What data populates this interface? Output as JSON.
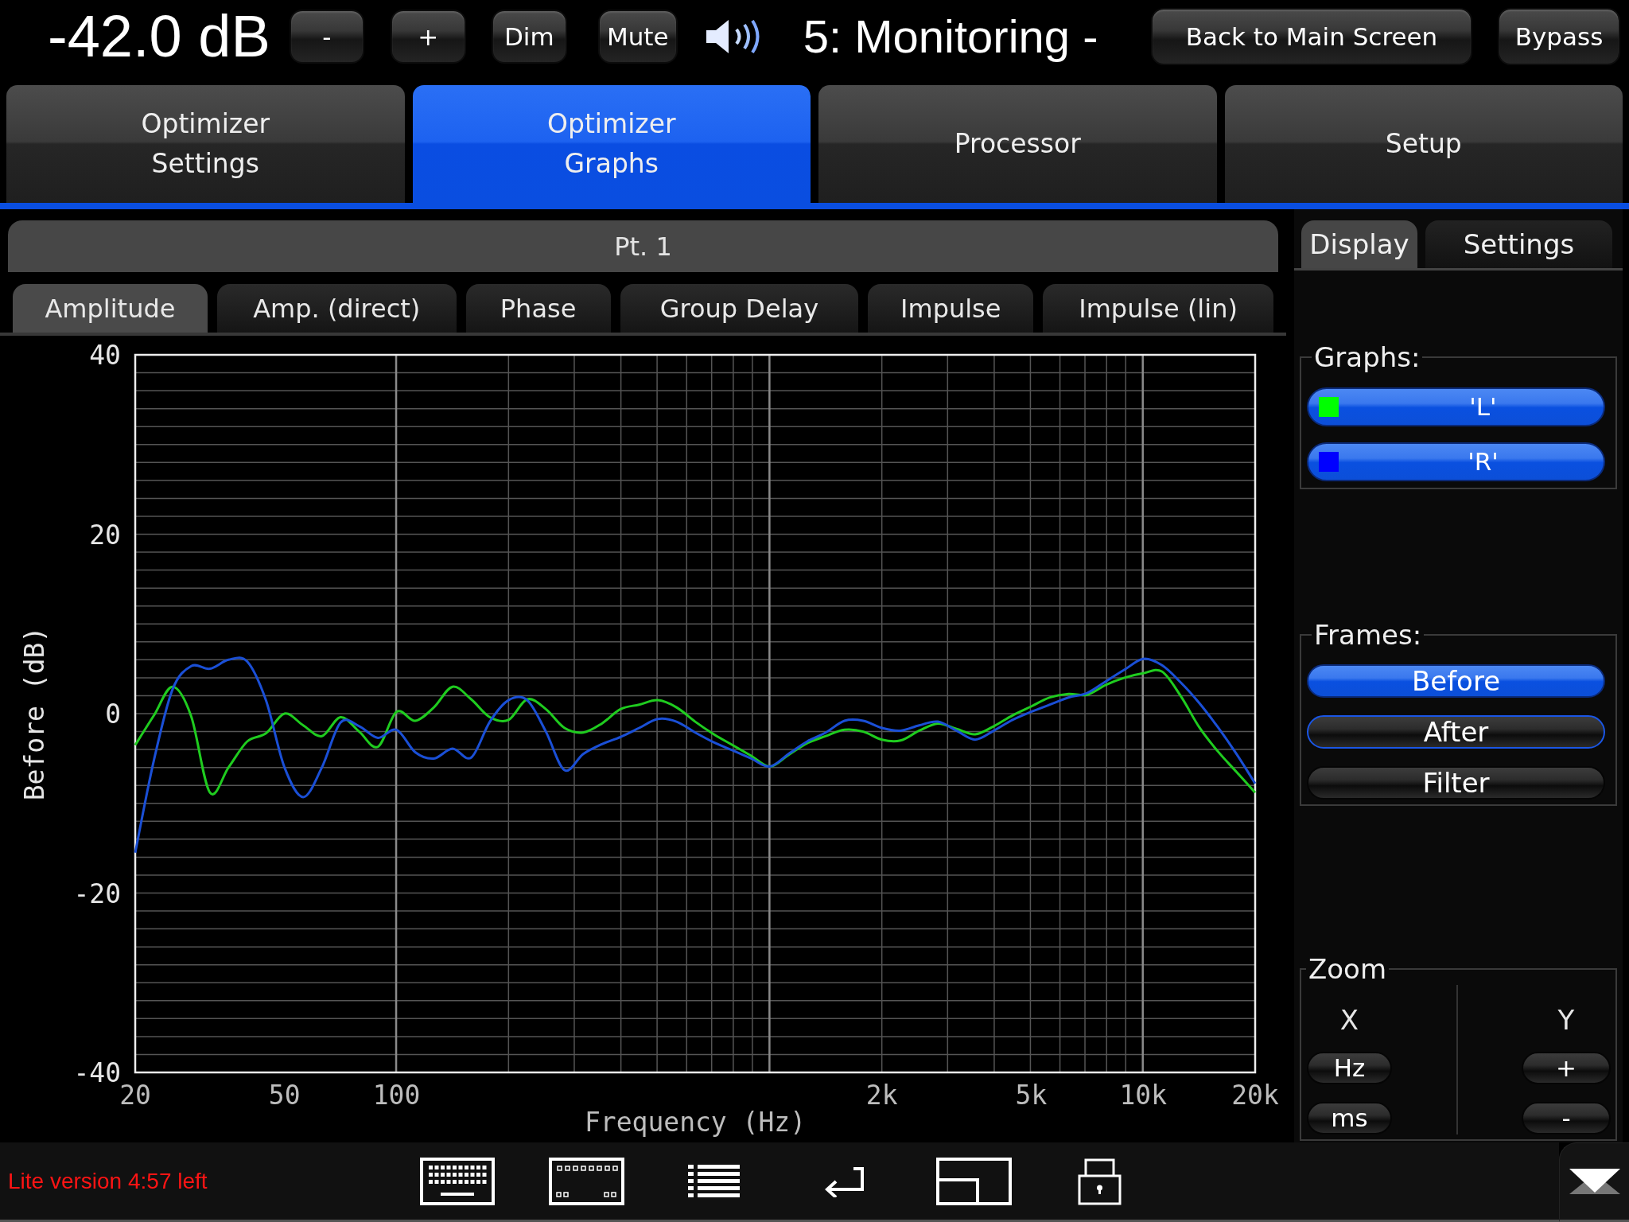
{
  "top_bar": {
    "volume": "-42.0 dB",
    "buttons": [
      "-",
      "+",
      "Dim",
      "Mute"
    ],
    "preset": "5: Monitoring -",
    "right_buttons": [
      "Back to Main Screen",
      "Bypass"
    ]
  },
  "tabs": [
    {
      "label": "Optimizer Settings",
      "selected": false
    },
    {
      "label": "Optimizer Graphs",
      "selected": true
    },
    {
      "label": "Processor",
      "selected": false
    },
    {
      "label": "Setup",
      "selected": false
    }
  ],
  "graph_panel": {
    "title": "Pt. 1",
    "tabs": [
      {
        "label": "Amplitude",
        "selected": true
      },
      {
        "label": "Amp. (direct)",
        "selected": false
      },
      {
        "label": "Phase",
        "selected": false
      },
      {
        "label": "Group Delay",
        "selected": false
      },
      {
        "label": "Impulse",
        "selected": false
      },
      {
        "label": "Impulse (lin)",
        "selected": false
      }
    ],
    "chart_data": {
      "type": "line",
      "xlabel": "Frequency (Hz)",
      "ylabel": "Before (dB)",
      "grid": true,
      "categories": [
        "20",
        null,
        null,
        null,
        null,
        null,
        null,
        null,
        "50",
        null,
        null,
        null,
        null,
        null,
        "100",
        null,
        null,
        null,
        null,
        null,
        null,
        null,
        null,
        null,
        null,
        null,
        null,
        null,
        null,
        null,
        null,
        null,
        null,
        null,
        null,
        null,
        null,
        null,
        null,
        null,
        "2k",
        null,
        null,
        null,
        null,
        null,
        null,
        null,
        "5k",
        null,
        null,
        null,
        null,
        null,
        "10k",
        null,
        null,
        null,
        null,
        null,
        "20k"
      ],
      "series": [
        {
          "color": "#1fcc1f",
          "values": [
            -3.5,
            -0.2,
            3.0,
            -0.3,
            -8.8,
            -6.0,
            -3.1,
            -2.2,
            0,
            -1.3,
            -2.5,
            -0.4,
            -2.0,
            -3.7,
            0.2,
            -0.8,
            0.7,
            3.0,
            1.6,
            -0.4,
            -0.7,
            1.6,
            0.5,
            -1.6,
            -2.1,
            -1.1,
            0.5,
            1.0,
            1.5,
            0.7,
            -0.9,
            -2.3,
            -3.5,
            -4.7,
            -5.9,
            -4.6,
            -3.3,
            -2.5,
            -1.8,
            -2.0,
            -2.9,
            -3.0,
            -1.9,
            -1.1,
            -1.7,
            -2.3,
            -1.4,
            -0.2,
            0.8,
            1.8,
            2.2,
            2.1,
            3.2,
            4.0,
            4.5,
            4.7,
            2.0,
            -1.5,
            -4.2,
            -6.5,
            -8.8
          ]
        },
        {
          "color": "#1a4fd6",
          "values": [
            -15.5,
            -5.2,
            2.7,
            5.3,
            5.0,
            6.0,
            5.8,
            1.5,
            -6.0,
            -9.3,
            -6.0,
            -1.0,
            -1.4,
            -2.7,
            -1.8,
            -4.3,
            -5.0,
            -3.9,
            -4.9,
            -0.9,
            1.5,
            1.5,
            -2.0,
            -6.3,
            -4.5,
            -3.4,
            -2.6,
            -1.6,
            -0.6,
            -0.9,
            -2.1,
            -3.2,
            -4.1,
            -5.0,
            -5.9,
            -4.5,
            -3.1,
            -2.1,
            -0.8,
            -0.8,
            -1.6,
            -1.9,
            -1.3,
            -0.9,
            -1.9,
            -2.9,
            -1.9,
            -0.7,
            0.2,
            1.0,
            1.8,
            2.3,
            3.6,
            4.9,
            6.1,
            5.4,
            3.5,
            1.2,
            -1.5,
            -4.5,
            -7.8
          ]
        }
      ],
      "ylim": [
        -40,
        40
      ],
      "yticks": [
        -40,
        -20,
        0,
        20,
        40
      ]
    }
  },
  "side_panel": {
    "tabs": [
      {
        "label": "Display",
        "selected": true
      },
      {
        "label": "Settings",
        "selected": false
      }
    ],
    "graphs": {
      "title": "Graphs:",
      "items": [
        {
          "label": "'L'",
          "color": "#00ff00",
          "on": true
        },
        {
          "label": "'R'",
          "color": "#0000ff",
          "on": true
        }
      ]
    },
    "frames": {
      "title": "Frames:",
      "items": [
        {
          "label": "Before",
          "selected": true,
          "focused": false
        },
        {
          "label": "After",
          "selected": false,
          "focused": true
        },
        {
          "label": "Filter",
          "selected": false,
          "focused": false
        }
      ]
    },
    "zoom": {
      "title": "Zoom",
      "x": {
        "label": "X",
        "buttons": [
          "Hz",
          "ms"
        ]
      },
      "y": {
        "label": "Y",
        "buttons": [
          "+",
          "-"
        ]
      }
    }
  },
  "bottom_bar": {
    "notice": "Lite version 4:57 left"
  }
}
